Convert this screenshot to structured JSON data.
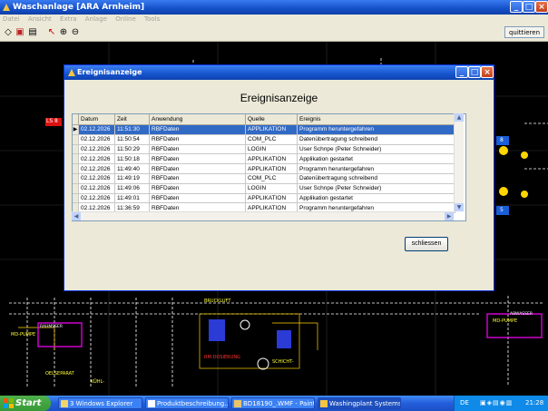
{
  "app": {
    "title": "Waschanlage [ARA Arnheim]",
    "menu": [
      "Datei",
      "Ansicht",
      "Extra",
      "Anlage",
      "Online",
      "Tools"
    ],
    "quit_label": "quittieren"
  },
  "schematic": {
    "labels": [
      "LS 8",
      "MD-PUMPE",
      "BRUCKLUFT",
      "MD-PUMPE",
      "OELSEPARAT",
      "KÜHL-",
      "RM-DOSIERUNG",
      "SCHICHT-",
      "8",
      "5",
      "RAHMSSER",
      "ABWASSER"
    ]
  },
  "dialog": {
    "title": "Ereignisanzeige",
    "heading": "Ereignisanzeige",
    "columns": [
      "Datum",
      "Zeit",
      "Anwendung",
      "Quelle",
      "Ereignis"
    ],
    "rows": [
      [
        "02.12.2026",
        "11:51:30",
        "RBFDaten",
        "APPLIKATION",
        "Programm heruntergefahren"
      ],
      [
        "02.12.2026",
        "11:50:54",
        "RBFDaten",
        "COM_PLC",
        "Datenübertragung schreibend"
      ],
      [
        "02.12.2026",
        "11:50:29",
        "RBFDaten",
        "LOGIN",
        "User Schnpe (Peter Schneider)"
      ],
      [
        "02.12.2026",
        "11:50:18",
        "RBFDaten",
        "APPLIKATION",
        "Applikation gestartet"
      ],
      [
        "02.12.2026",
        "11:49:40",
        "RBFDaten",
        "APPLIKATION",
        "Programm heruntergefahren"
      ],
      [
        "02.12.2026",
        "11:49:19",
        "RBFDaten",
        "COM_PLC",
        "Datenübertragung schreibend"
      ],
      [
        "02.12.2026",
        "11:49:06",
        "RBFDaten",
        "LOGIN",
        "User Schnpe (Peter Schneider)"
      ],
      [
        "02.12.2026",
        "11:49:01",
        "RBFDaten",
        "APPLIKATION",
        "Applikation gestartet"
      ],
      [
        "02.12.2026",
        "11:36:59",
        "RBFDaten",
        "APPLIKATION",
        "Programm heruntergefahren"
      ]
    ],
    "close_label": "schliessen"
  },
  "taskbar": {
    "start": "Start",
    "tasks": [
      "3 Windows Explorer",
      "Produktbeschreibung...",
      "BD18190_.WMF - Paint",
      "Washingplant Systems"
    ],
    "lang": "DE",
    "clock": "21:28"
  },
  "colors": {
    "selection": "#316ac5",
    "titlebar": "#1553cc",
    "schematic_bg": "#000000"
  }
}
